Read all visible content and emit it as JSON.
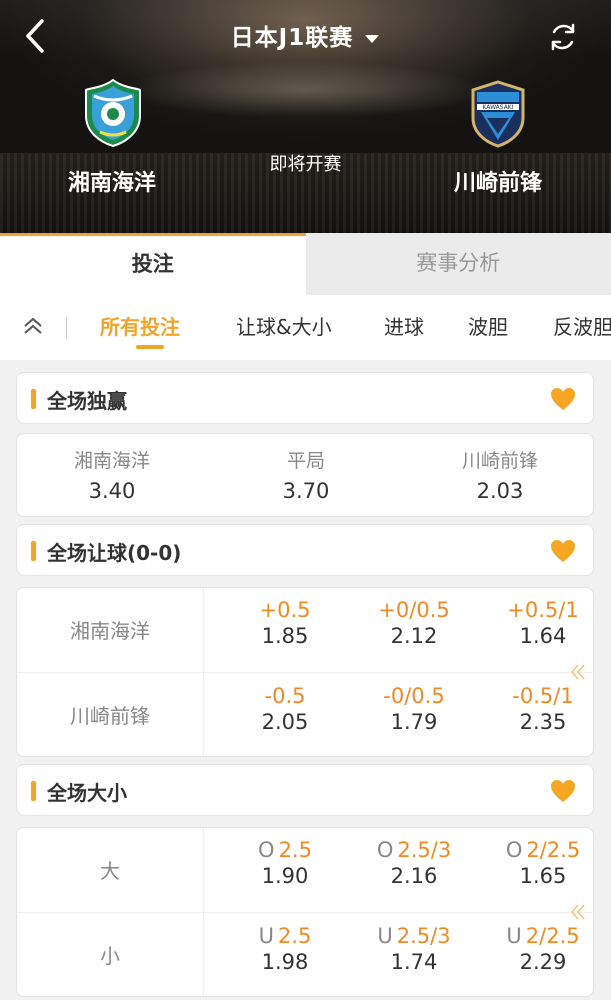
{
  "header": {
    "league_title": "日本J1联赛",
    "match_status": "即将开赛",
    "home_team": "湘南海洋",
    "away_team": "川崎前锋",
    "away_logo_text": "KAWASAKI"
  },
  "main_tabs": [
    {
      "label": "投注",
      "active": true
    },
    {
      "label": "赛事分析",
      "active": false
    }
  ],
  "sub_tabs": [
    {
      "label": "所有投注",
      "active": true
    },
    {
      "label": "让球&大小",
      "active": false
    },
    {
      "label": "进球",
      "active": false
    },
    {
      "label": "波胆",
      "active": false
    },
    {
      "label": "反波胆",
      "active": false
    }
  ],
  "markets": {
    "match_winner": {
      "title": "全场独赢",
      "options": [
        {
          "label": "湘南海洋",
          "odds": "3.40"
        },
        {
          "label": "平局",
          "odds": "3.70"
        },
        {
          "label": "川崎前锋",
          "odds": "2.03"
        }
      ]
    },
    "handicap": {
      "title": "全场让球(0-0)",
      "rows": [
        {
          "label": "湘南海洋",
          "cells": [
            {
              "prefix": "",
              "line": "+0.5",
              "odds": "1.85"
            },
            {
              "prefix": "",
              "line": "+0/0.5",
              "odds": "2.12"
            },
            {
              "prefix": "",
              "line": "+0.5/1",
              "odds": "1.64"
            }
          ]
        },
        {
          "label": "川崎前锋",
          "cells": [
            {
              "prefix": "",
              "line": "-0.5",
              "odds": "2.05"
            },
            {
              "prefix": "",
              "line": "-0/0.5",
              "odds": "1.79"
            },
            {
              "prefix": "",
              "line": "-0.5/1",
              "odds": "2.35"
            }
          ]
        }
      ]
    },
    "totals": {
      "title": "全场大小",
      "rows": [
        {
          "label": "大",
          "cells": [
            {
              "prefix": "O",
              "line": "2.5",
              "odds": "1.90"
            },
            {
              "prefix": "O",
              "line": "2.5/3",
              "odds": "2.16"
            },
            {
              "prefix": "O",
              "line": "2/2.5",
              "odds": "1.65"
            }
          ]
        },
        {
          "label": "小",
          "cells": [
            {
              "prefix": "U",
              "line": "2.5",
              "odds": "1.98"
            },
            {
              "prefix": "U",
              "line": "2.5/3",
              "odds": "1.74"
            },
            {
              "prefix": "U",
              "line": "2/2.5",
              "odds": "2.29"
            }
          ]
        }
      ]
    }
  },
  "colors": {
    "accent": "#f0a52a",
    "line_text": "#f08a24",
    "muted_text": "#888888"
  }
}
